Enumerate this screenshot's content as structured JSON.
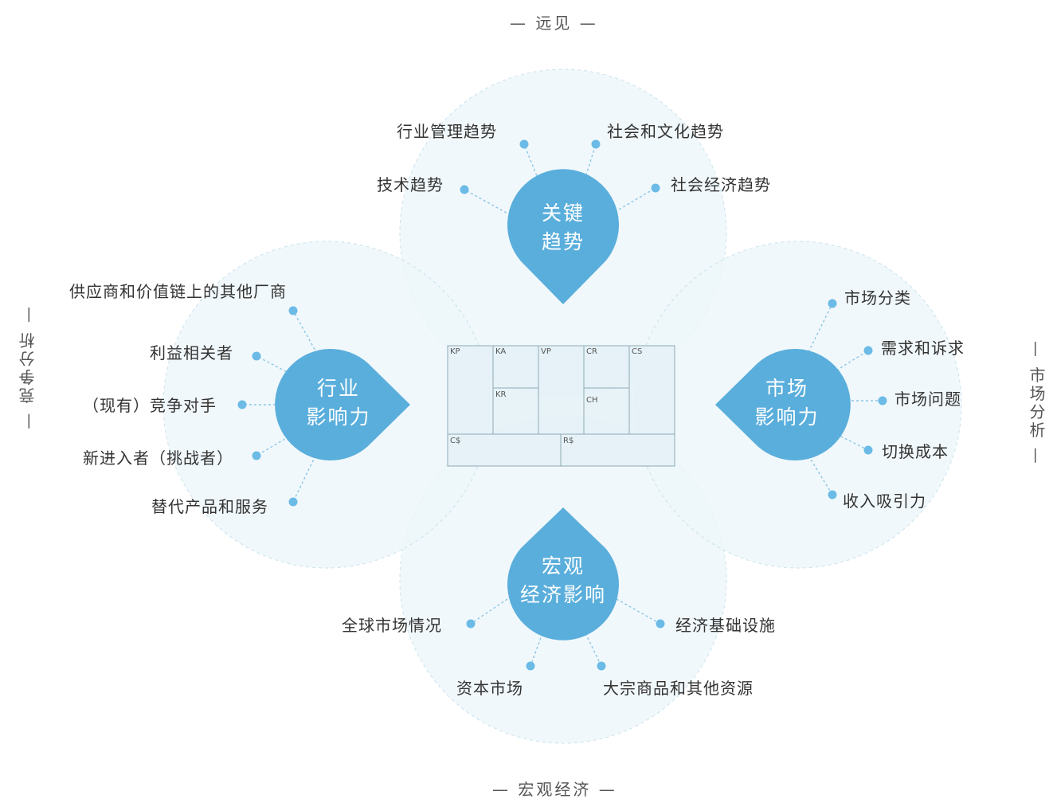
{
  "axes": {
    "top": "— 远见 —",
    "bottom": "— 宏观经济 —",
    "left": "— 竞争分析 —",
    "right": "— 市场分析 —"
  },
  "quadrants": {
    "top": {
      "title_line1": "关键",
      "title_line2": "趋势",
      "items": [
        "行业管理趋势",
        "社会和文化趋势",
        "技术趋势",
        "社会经济趋势"
      ]
    },
    "left": {
      "title_line1": "行业",
      "title_line2": "影响力",
      "items": [
        "供应商和价值链上的其他厂商",
        "利益相关者",
        "（现有）竞争对手",
        "新进入者（挑战者）",
        "替代产品和服务"
      ]
    },
    "right": {
      "title_line1": "市场",
      "title_line2": "影响力",
      "items": [
        "市场分类",
        "需求和诉求",
        "市场问题",
        "切换成本",
        "收入吸引力"
      ]
    },
    "bottom": {
      "title_line1": "宏观",
      "title_line2": "经济影响",
      "items": [
        "全球市场情况",
        "经济基础设施",
        "资本市场",
        "大宗商品和其他资源"
      ]
    }
  },
  "canvas": {
    "cells": [
      "KP",
      "KA",
      "VP",
      "CR",
      "CS",
      "KR",
      "CH",
      "C$",
      "R$"
    ]
  },
  "colors": {
    "drop": "#5aaedc",
    "dot": "#6bbbe6",
    "halo": "#eef6fa",
    "halo_stroke": "#c9e2ee",
    "canvas_fill": "#e4f1f7",
    "canvas_stroke": "#8fa9b5"
  }
}
